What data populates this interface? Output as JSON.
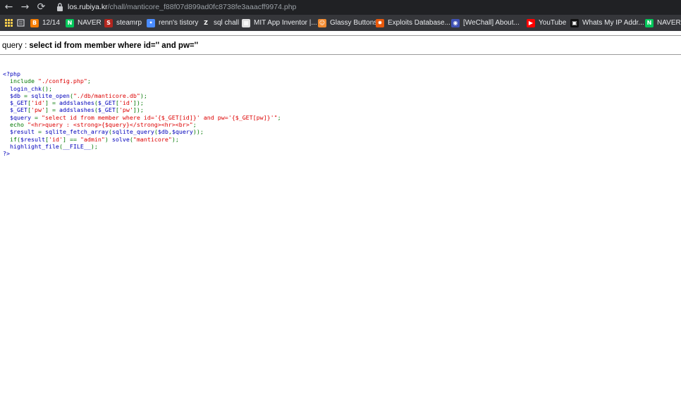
{
  "browser": {
    "url_host": "los.rubiya.kr",
    "url_path": "/chall/manticore_f88f07d899ad0fc8738fe3aaacff9974.php"
  },
  "bookmarks": [
    {
      "label": "12/14",
      "icon": "blogger-icon",
      "color": "#f57d00",
      "glyph": "B"
    },
    {
      "label": "NAVER",
      "icon": "naver-icon",
      "color": "#03c75a",
      "glyph": "N"
    },
    {
      "label": "steamrp",
      "icon": "steamrp-icon",
      "color": "#b3261e",
      "glyph": "S"
    },
    {
      "label": "renn's tistory",
      "icon": "tistory-icon",
      "color": "#4a8cff",
      "glyph": "•"
    },
    {
      "label": "sql chall",
      "icon": "z-icon",
      "color": "#35363a",
      "glyph": "Z"
    },
    {
      "label": "MIT App Inventor |...",
      "icon": "app-inventor-icon",
      "color": "#e0e0e0",
      "glyph": "▦"
    },
    {
      "label": "Glassy Buttons",
      "icon": "glassy-icon",
      "color": "#f28b30",
      "glyph": "☺"
    },
    {
      "label": "Exploits Database...",
      "icon": "exploitdb-icon",
      "color": "#e8590c",
      "glyph": "✸"
    },
    {
      "label": "[WeChall] About...",
      "icon": "wechall-icon",
      "color": "#3f51b5",
      "glyph": "◉"
    },
    {
      "label": "YouTube",
      "icon": "youtube-icon",
      "color": "#ff0000",
      "glyph": "▶"
    },
    {
      "label": "Whats My IP Addr...",
      "icon": "whatsmyip-icon",
      "color": "#111111",
      "glyph": "▣"
    },
    {
      "label": "NAVER",
      "icon": "naver-icon",
      "color": "#03c75a",
      "glyph": "N"
    }
  ],
  "page": {
    "query_prefix": "query : ",
    "query_value": "select id from member where id='' and pw=''"
  },
  "source": {
    "open_tag": "<?php",
    "close_tag": "?>",
    "lines": [
      [
        "  ",
        [
          "k",
          "include "
        ],
        [
          "s",
          "\"./config.php\""
        ],
        [
          "k",
          ";"
        ]
      ],
      [
        "  ",
        [
          "d",
          "login_chk"
        ],
        [
          "k",
          "();"
        ]
      ],
      [
        "  ",
        [
          "d",
          "$db "
        ],
        [
          "k",
          "= "
        ],
        [
          "d",
          "sqlite_open"
        ],
        [
          "k",
          "("
        ],
        [
          "s",
          "\"./db/manticore.db\""
        ],
        [
          "k",
          ");"
        ]
      ],
      [
        "  ",
        [
          "d",
          "$_GET"
        ],
        [
          "k",
          "["
        ],
        [
          "s",
          "'id'"
        ],
        [
          "k",
          "] = "
        ],
        [
          "d",
          "addslashes"
        ],
        [
          "k",
          "("
        ],
        [
          "d",
          "$_GET"
        ],
        [
          "k",
          "["
        ],
        [
          "s",
          "'id'"
        ],
        [
          "k",
          "]);"
        ]
      ],
      [
        "  ",
        [
          "d",
          "$_GET"
        ],
        [
          "k",
          "["
        ],
        [
          "s",
          "'pw'"
        ],
        [
          "k",
          "] = "
        ],
        [
          "d",
          "addslashes"
        ],
        [
          "k",
          "("
        ],
        [
          "d",
          "$_GET"
        ],
        [
          "k",
          "["
        ],
        [
          "s",
          "'pw'"
        ],
        [
          "k",
          "]);"
        ]
      ],
      [
        "  ",
        [
          "d",
          "$query "
        ],
        [
          "k",
          "= "
        ],
        [
          "s",
          "\"select id from member where id='{$_GET[id]}' and pw='{$_GET[pw]}'\""
        ],
        [
          "k",
          ";"
        ]
      ],
      [
        "  ",
        [
          "k",
          "echo "
        ],
        [
          "s",
          "\"<hr>query : <strong>{$query}</strong><hr><br>\""
        ],
        [
          "k",
          ";"
        ]
      ],
      [
        "  ",
        [
          "d",
          "$result "
        ],
        [
          "k",
          "= "
        ],
        [
          "d",
          "sqlite_fetch_array"
        ],
        [
          "k",
          "("
        ],
        [
          "d",
          "sqlite_query"
        ],
        [
          "k",
          "("
        ],
        [
          "d",
          "$db"
        ],
        [
          "k",
          ","
        ],
        [
          "d",
          "$query"
        ],
        [
          "k",
          "));"
        ]
      ],
      [
        "  ",
        [
          "k",
          "if("
        ],
        [
          "d",
          "$result"
        ],
        [
          "k",
          "["
        ],
        [
          "s",
          "'id'"
        ],
        [
          "k",
          "] == "
        ],
        [
          "s",
          "\"admin\""
        ],
        [
          "k",
          ") "
        ],
        [
          "d",
          "solve"
        ],
        [
          "k",
          "("
        ],
        [
          "s",
          "\"manticore\""
        ],
        [
          "k",
          ");"
        ]
      ],
      [
        "  ",
        [
          "d",
          "highlight_file"
        ],
        [
          "k",
          "("
        ],
        [
          "d",
          "__FILE__"
        ],
        [
          "k",
          ");"
        ]
      ]
    ]
  }
}
